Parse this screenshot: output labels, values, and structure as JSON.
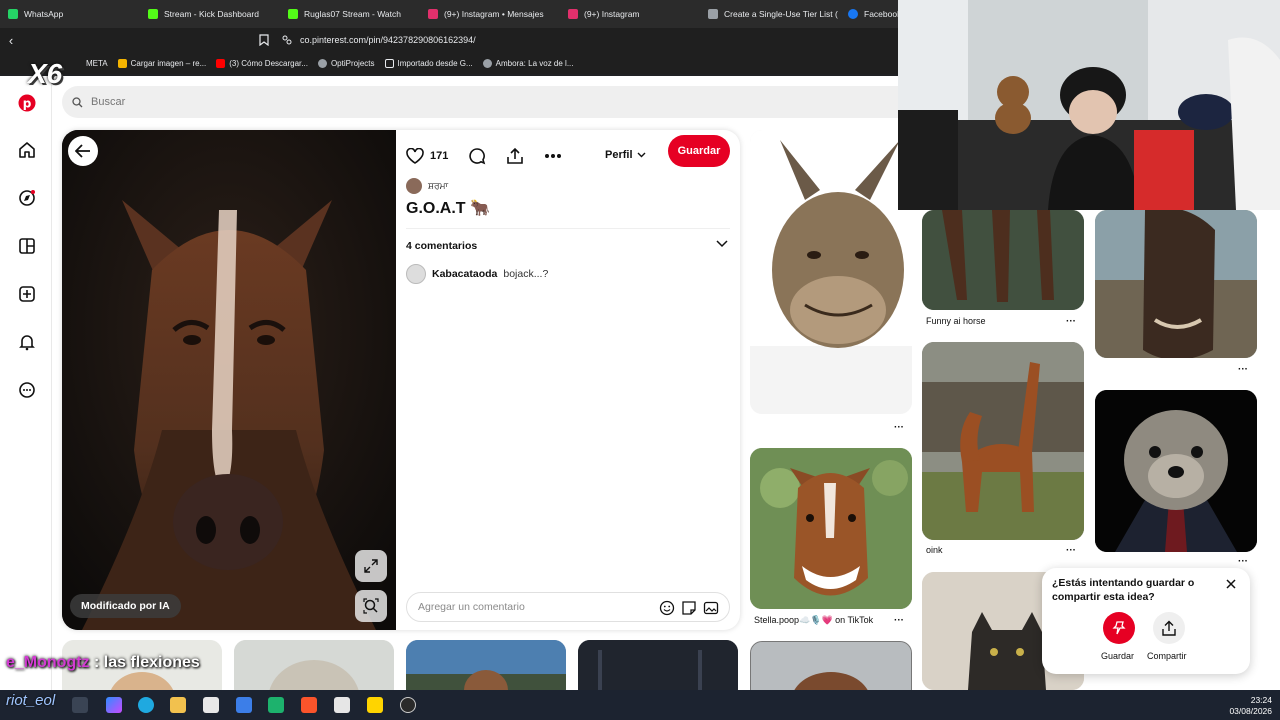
{
  "browser": {
    "tabs": [
      {
        "label": "WhatsApp",
        "color": "#25d366"
      },
      {
        "label": "Stream - Kick Dashboard",
        "color": "#53fc18"
      },
      {
        "label": "Ruglas07 Stream - Watch",
        "color": "#53fc18"
      },
      {
        "label": "(9+) Instagram • Mensajes",
        "color": "#e1306c"
      },
      {
        "label": "(9+) Instagram",
        "color": "#e1306c"
      },
      {
        "label": "Create a Single-Use Tier List (",
        "color": "#9aa0a6"
      },
      {
        "label": "Facebook",
        "color": "#1877f2"
      }
    ],
    "url": "co.pinterest.com/pin/942378290806162394/",
    "bookmarks": [
      {
        "label": "META",
        "color": "#9aa0a6"
      },
      {
        "label": "Cargar imagen – re...",
        "color": "#f4b400"
      },
      {
        "label": "(3) Cómo Descargar...",
        "color": "#ff0000"
      },
      {
        "label": "OptiProjects",
        "color": "#9aa0a6"
      },
      {
        "label": "Importado desde G...",
        "color": "#9aa0a6"
      },
      {
        "label": "Ambora: La voz de l...",
        "color": "#9aa0a6"
      }
    ]
  },
  "search": {
    "placeholder": "Buscar"
  },
  "pin": {
    "likes": "171",
    "perfil_label": "Perfil",
    "save_label": "Guardar",
    "author": "ਸ਼ਰਮਾ",
    "title": "G.O.A.T 🐂",
    "comments_count_label": "4 comentarios",
    "comment": {
      "user": "Kabacataoda",
      "text": "bojack...?"
    },
    "ai_badge": "Modificado por IA",
    "comment_placeholder": "Agregar un comentario"
  },
  "tiles": [
    {
      "caption": "Funny ai horse"
    },
    {
      "caption": "oink"
    },
    {
      "caption": "Stella.poop☁️🎙️💗 on TikTok"
    }
  ],
  "popup": {
    "question": "¿Estás intentando guardar o compartir esta idea?",
    "save_label": "Guardar",
    "share_label": "Compartir"
  },
  "overlay": {
    "multiplier": "X6",
    "chat_user": "e_Monogtz",
    "chat_text": ": las flexiones",
    "riot": "riot_eol"
  },
  "taskbar": {
    "time": "23:24",
    "date": "03/08/2026"
  },
  "colors": {
    "pinterest_red": "#e60023"
  }
}
